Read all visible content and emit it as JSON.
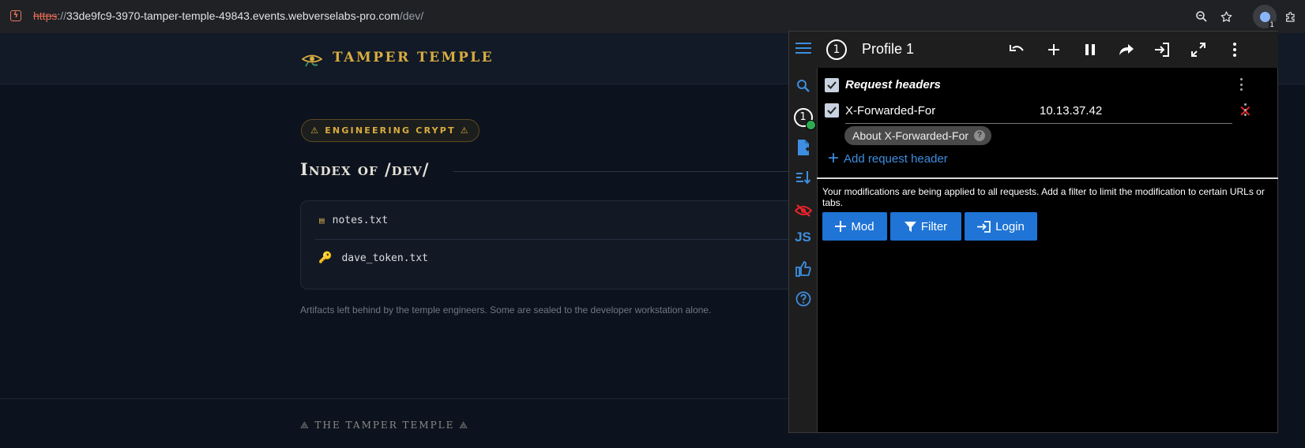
{
  "browser": {
    "url_scheme": "https",
    "url_separator": "://",
    "url_host": "33de9fc9-3970-tamper-temple-49843.events.webverselabs-pro.com",
    "url_path": "/dev/",
    "extension_badge_count": "1",
    "icons": [
      "site-info-icon",
      "zoom-icon",
      "bookmark-star-icon",
      "extension-icon",
      "extensions-puzzle-icon"
    ]
  },
  "site": {
    "brand": "TAMPER TEMPLE",
    "badge": "⚠ ENGINEERING CRYPT ⚠",
    "page_title": "Index of /dev/",
    "files": [
      {
        "name": "notes.txt",
        "icon": "▤"
      },
      {
        "name": "dave_token.txt",
        "icon": "🔑"
      }
    ],
    "caption": "Artifacts left behind by the temple engineers. Some are sealed to the developer workstation alone.",
    "footer": "⟁ THE TAMPER TEMPLE ⟁",
    "colors": {
      "accent_gold": "#d8ad3f",
      "background": "#0d131e"
    }
  },
  "extension": {
    "profile_number": "1",
    "profile_name": "Profile 1",
    "sidebar_profile_number": "1",
    "section_title": "Request headers",
    "header": {
      "name": "X-Forwarded-For",
      "value": "10.13.37.42",
      "enabled": true,
      "about_label": "About X-Forwarded-For",
      "help": "?"
    },
    "add_header_label": "Add request header",
    "notice": "Your modifications are being applied to all requests. Add a filter to limit the modification to certain URLs or tabs.",
    "buttons": {
      "mod": "Mod",
      "filter": "Filter",
      "login": "Login"
    },
    "sidebar_js_label": "JS",
    "remove_symbol": "✕",
    "colors": {
      "accent_blue": "#1f74d6",
      "remove_red": "#e8232a"
    }
  }
}
